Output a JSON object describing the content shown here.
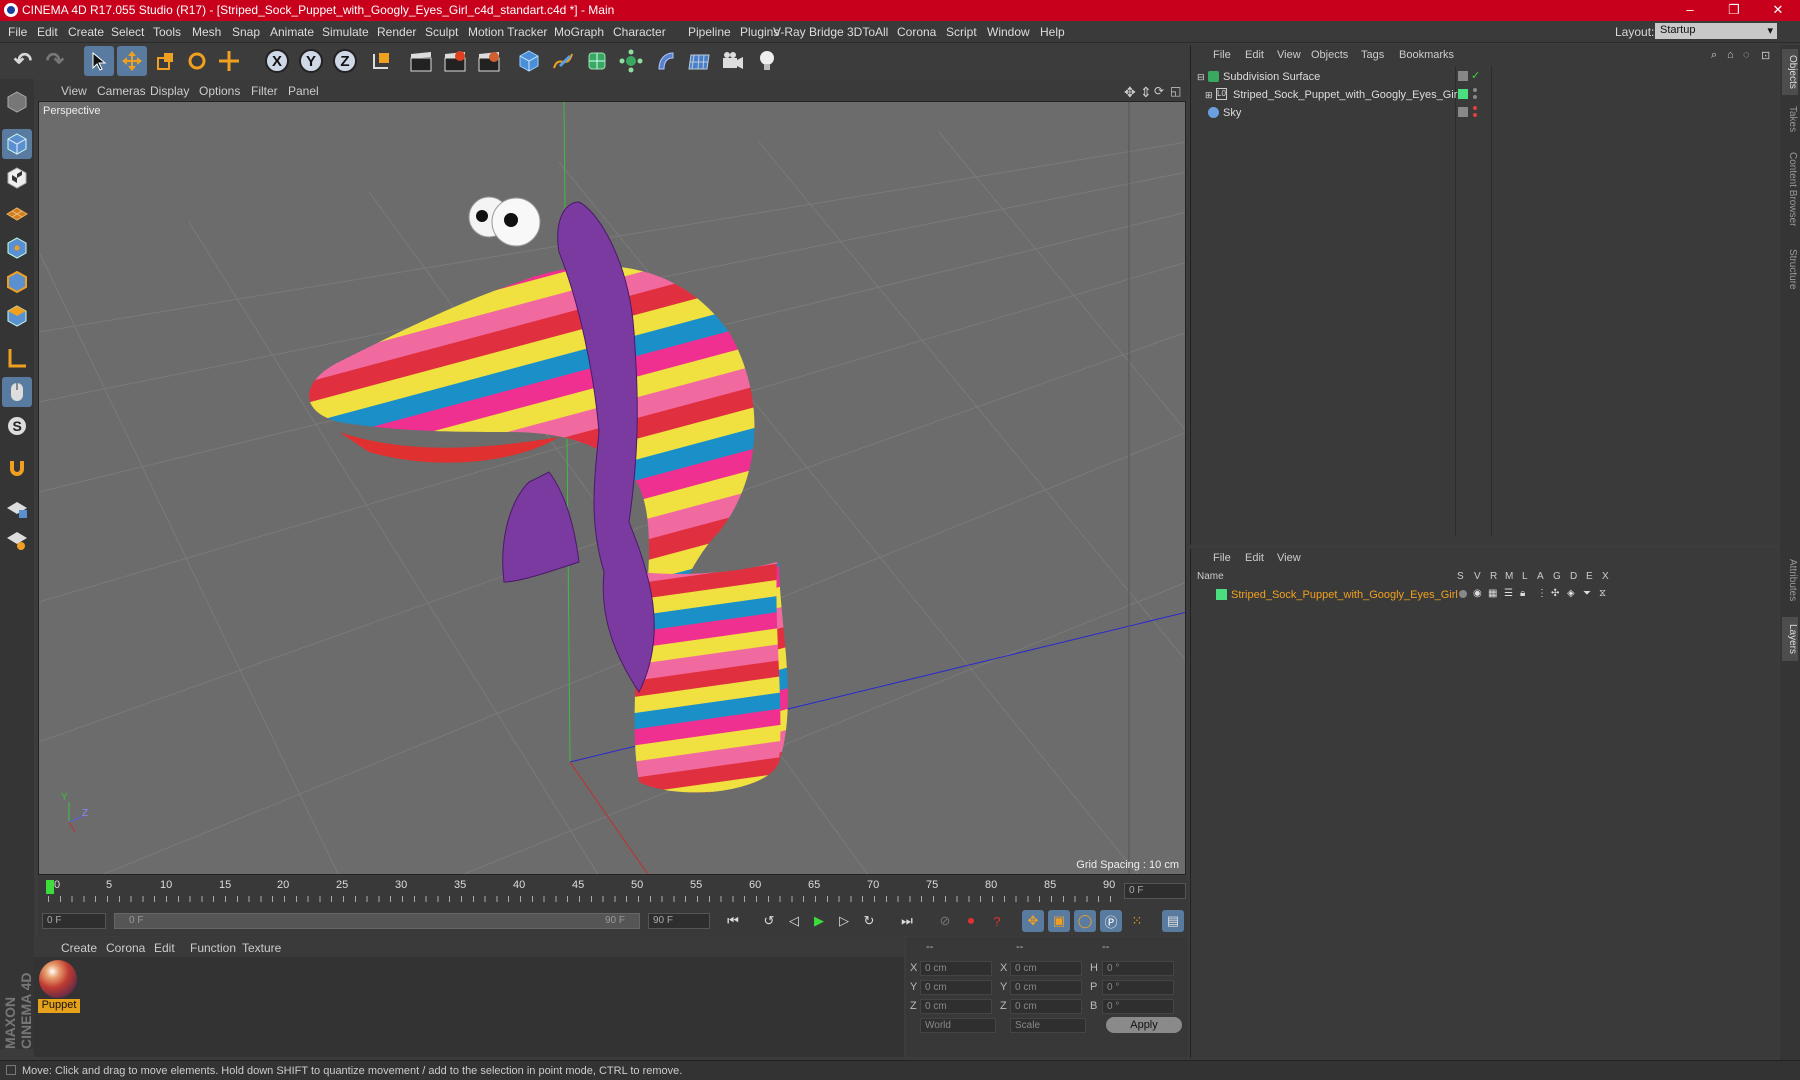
{
  "window": {
    "title": "CINEMA 4D R17.055 Studio (R17) - [Striped_Sock_Puppet_with_Googly_Eyes_Girl_c4d_standart.c4d *] - Main",
    "minimize": "–",
    "maximize": "❐",
    "close": "✕"
  },
  "menubar": {
    "items": [
      "File",
      "Edit",
      "Create",
      "Select",
      "Tools",
      "Mesh",
      "Snap",
      "Animate",
      "Simulate",
      "Render",
      "Sculpt",
      "Motion Tracker",
      "MoGraph",
      "Character",
      "Pipeline",
      "Plugins",
      "V-Ray Bridge",
      "3DToAll",
      "Corona",
      "Script",
      "Window",
      "Help"
    ],
    "layout_label": "Layout:",
    "layout_value": "Startup"
  },
  "toolbar": {
    "undo": "↶",
    "redo": "↷",
    "axis_x": "X",
    "axis_y": "Y",
    "axis_z": "Z"
  },
  "viewport": {
    "menu": [
      "View",
      "Cameras",
      "Display",
      "Options",
      "Filter",
      "Panel"
    ],
    "label": "Perspective",
    "grid_spacing": "Grid Spacing : 10 cm",
    "axis_y": "Y",
    "axis_z": "Z"
  },
  "timeline": {
    "ticks": [
      "0",
      "5",
      "10",
      "15",
      "20",
      "25",
      "30",
      "35",
      "40",
      "45",
      "50",
      "55",
      "60",
      "65",
      "70",
      "75",
      "80",
      "85",
      "90"
    ],
    "current_frame": "0 F",
    "start_field": "0 F",
    "range_start": "0 F",
    "range_end": "90 F",
    "end_field": "90 F"
  },
  "material_manager": {
    "menu": [
      "Create",
      "Corona",
      "Edit",
      "Function",
      "Texture"
    ],
    "material_name": "Puppet"
  },
  "coordinates": {
    "col_headers": [
      "--",
      "--",
      "--"
    ],
    "rows": [
      {
        "l1": "X",
        "v1": "0 cm",
        "l2": "X",
        "v2": "0 cm",
        "l3": "H",
        "v3": "0 °"
      },
      {
        "l1": "Y",
        "v1": "0 cm",
        "l2": "Y",
        "v2": "0 cm",
        "l3": "P",
        "v3": "0 °"
      },
      {
        "l1": "Z",
        "v1": "0 cm",
        "l2": "Z",
        "v2": "0 cm",
        "l3": "B",
        "v3": "0 °"
      }
    ],
    "mode1": "World",
    "mode2": "Scale",
    "apply": "Apply"
  },
  "object_manager": {
    "menu": [
      "File",
      "Edit",
      "View",
      "Objects",
      "Tags",
      "Bookmarks"
    ],
    "objects": [
      {
        "name": "Subdivision Surface"
      },
      {
        "name": "Striped_Sock_Puppet_with_Googly_Eyes_Girl"
      },
      {
        "name": "Sky"
      }
    ]
  },
  "layer_manager": {
    "menu": [
      "File",
      "Edit",
      "View"
    ],
    "columns": [
      "Name",
      "S",
      "V",
      "R",
      "M",
      "L",
      "A",
      "G",
      "D",
      "E",
      "X"
    ],
    "layers": [
      {
        "name": "Striped_Sock_Puppet_with_Googly_Eyes_Girl"
      }
    ]
  },
  "right_tabs": [
    "Objects",
    "Takes",
    "Content Browser",
    "Structure",
    "Attributes",
    "Layers"
  ],
  "branding": "MAXON CINEMA 4D",
  "status": "Move: Click and drag to move elements. Hold down SHIFT to quantize movement / add to the selection in point mode, CTRL to remove.",
  "colors": {
    "title_bar": "#c8001c",
    "selection": "#5a7ba0",
    "accent_orange": "#e6a21a",
    "layer_green": "#4ade80"
  }
}
